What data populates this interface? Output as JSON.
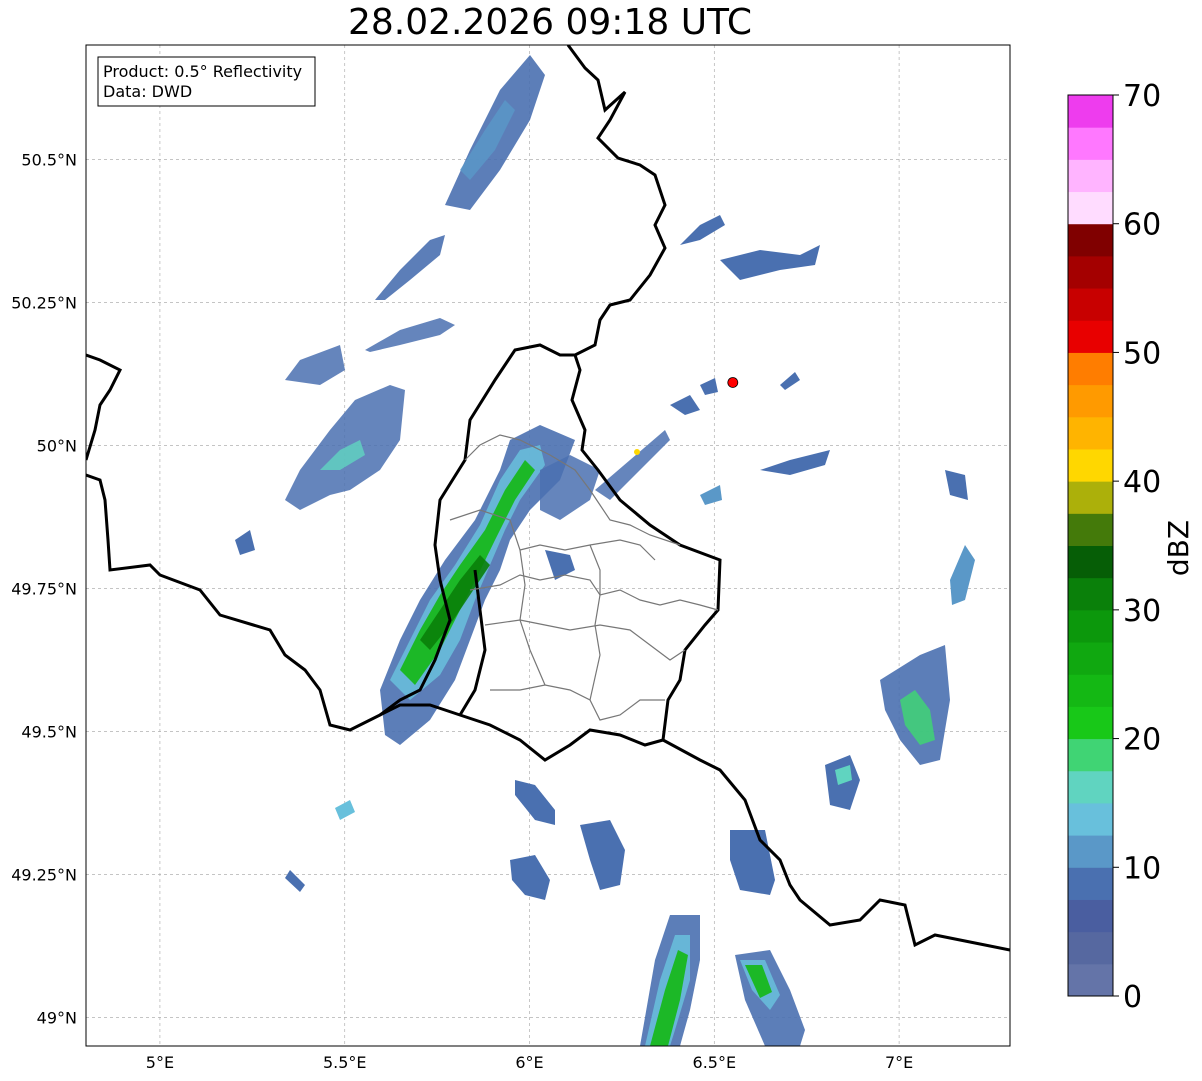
{
  "title": "28.02.2026 09:18 UTC",
  "info_box": {
    "product": "Product: 0.5° Reflectivity",
    "data": "Data: DWD"
  },
  "map": {
    "lon_range": [
      4.8,
      7.3
    ],
    "lat_range": [
      48.95,
      50.7
    ],
    "lon_ticks": [
      {
        "value": 5.0,
        "label": "5°E"
      },
      {
        "value": 5.5,
        "label": "5.5°E"
      },
      {
        "value": 6.0,
        "label": "6°E"
      },
      {
        "value": 6.5,
        "label": "6.5°E"
      },
      {
        "value": 7.0,
        "label": "7°E"
      }
    ],
    "lat_ticks": [
      {
        "value": 49.0,
        "label": "49°N"
      },
      {
        "value": 49.25,
        "label": "49.25°N"
      },
      {
        "value": 49.5,
        "label": "49.5°N"
      },
      {
        "value": 49.75,
        "label": "49.75°N"
      },
      {
        "value": 50.0,
        "label": "50°N"
      },
      {
        "value": 50.25,
        "label": "50.25°N"
      },
      {
        "value": 50.5,
        "label": "50.5°N"
      }
    ],
    "grid": true,
    "radar_site": {
      "lon": 6.55,
      "lat": 50.11,
      "color": "#ff0000"
    }
  },
  "colorbar": {
    "label": "dBZ",
    "min": 0,
    "max": 70,
    "tick_labels": [
      "0",
      "10",
      "20",
      "30",
      "40",
      "50",
      "60",
      "70"
    ],
    "colors": [
      "#6474a8",
      "#5668a0",
      "#4a5ea0",
      "#4a70b0",
      "#5a98c8",
      "#68c0dc",
      "#60d4c0",
      "#40d474",
      "#18c818",
      "#14b814",
      "#10a810",
      "#0c980c",
      "#0a800a",
      "#065e06",
      "#447a0a",
      "#acb00a",
      "#ffd700",
      "#ffb400",
      "#ff9a00",
      "#ff7d00",
      "#e80000",
      "#c80000",
      "#a40000",
      "#800000",
      "#ffdcff",
      "#ffb4ff",
      "#ff78ff",
      "#ee3cee"
    ]
  }
}
